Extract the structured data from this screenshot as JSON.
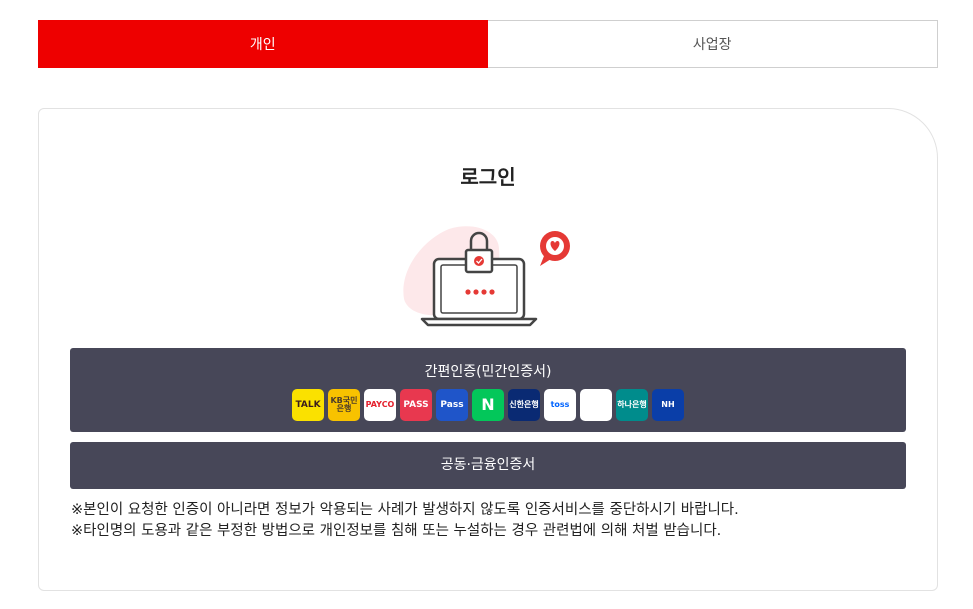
{
  "tabs": [
    {
      "label": "개인",
      "active": true
    },
    {
      "label": "사업장",
      "active": false
    }
  ],
  "login": {
    "title": "로그인",
    "simple_auth_label": "간편인증(민간인증서)",
    "cert_auth_label": "공동·금융인증서",
    "providers": [
      {
        "name": "kakao-talk",
        "text": "TALK",
        "bg": "#fae100",
        "fg": "#3a1d1d"
      },
      {
        "name": "kb",
        "text": "KB국민은행",
        "bg": "#f8c200",
        "fg": "#4a3a2a"
      },
      {
        "name": "payco",
        "text": "PAYCO",
        "bg": "#ffffff",
        "fg": "#e4202d"
      },
      {
        "name": "pass",
        "text": "PASS",
        "bg": "#e8384f",
        "fg": "#ffffff"
      },
      {
        "name": "samsung-pass",
        "text": "Pass",
        "bg": "#1f55c9",
        "fg": "#ffffff"
      },
      {
        "name": "naver",
        "text": "N",
        "bg": "#03c75a",
        "fg": "#ffffff"
      },
      {
        "name": "shinhan",
        "text": "신한은행",
        "bg": "#0a2a73",
        "fg": "#ffffff"
      },
      {
        "name": "toss",
        "text": "toss",
        "bg": "#ffffff",
        "fg": "#0064ff"
      },
      {
        "name": "banksalad",
        "text": "",
        "bg": "#ffffff",
        "fg": "#19c0a3"
      },
      {
        "name": "hana",
        "text": "하나은행",
        "bg": "#008c8c",
        "fg": "#ffffff"
      },
      {
        "name": "nh",
        "text": "NH",
        "bg": "#0a3ea8",
        "fg": "#ffffff"
      }
    ],
    "notes": [
      "※본인이 요청한 인증이 아니라면 정보가 악용되는 사례가 발생하지 않도록 인증서비스를 중단하시기 바랍니다.",
      "※타인명의 도용과 같은 부정한 방법으로 개인정보를 침해 또는 누설하는 경우 관련법에 의해 처벌 받습니다."
    ]
  },
  "colors": {
    "accent": "#ee0000",
    "button": "#474758"
  }
}
